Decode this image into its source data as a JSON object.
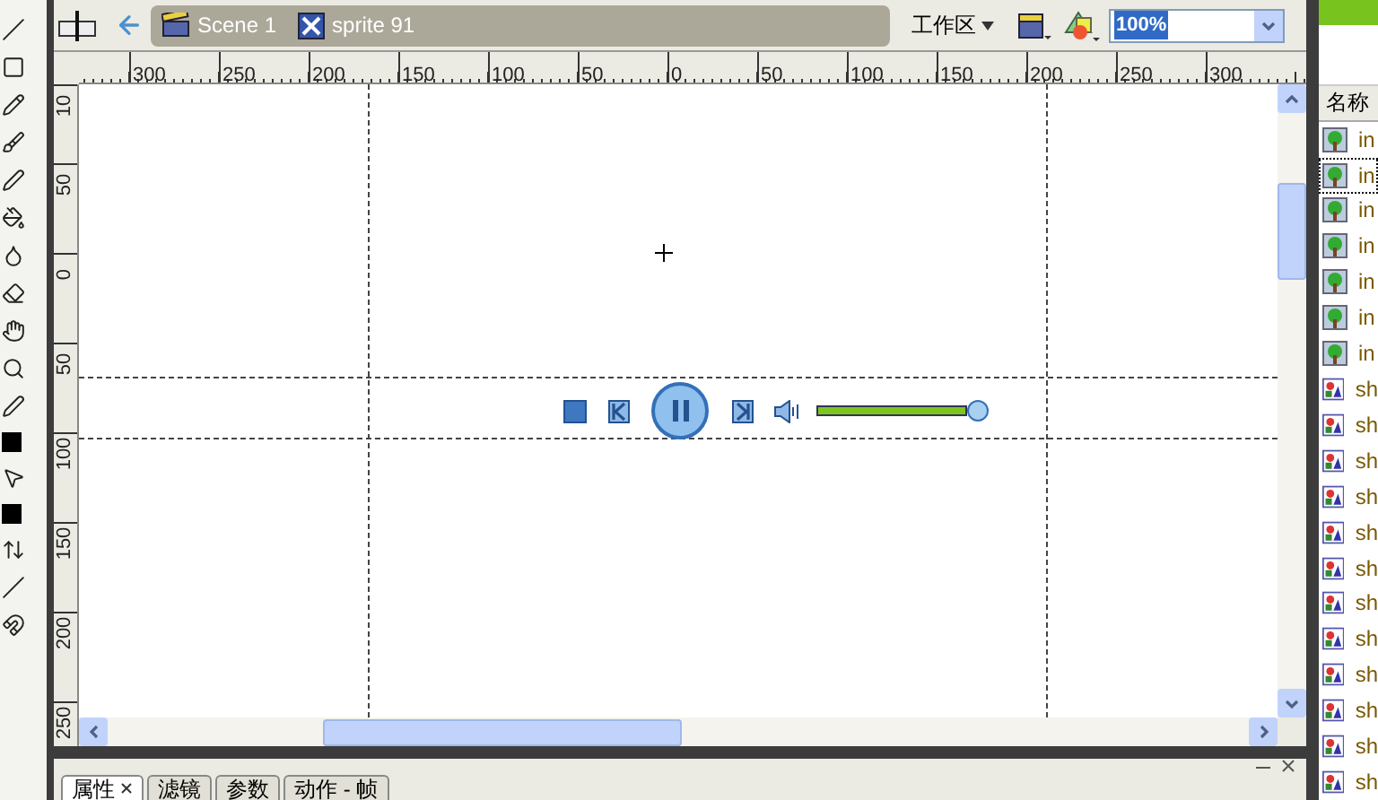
{
  "toolbar": {
    "breadcrumbs": [
      {
        "kind": "scene",
        "label": "Scene 1"
      },
      {
        "kind": "sprite",
        "label": "sprite 91"
      }
    ],
    "workspace_menu": "工作区",
    "zoom": "100%"
  },
  "ruler": {
    "horizontal": [
      "300",
      "250",
      "200",
      "150",
      "100",
      "50",
      "0",
      "50",
      "100",
      "150",
      "200",
      "250",
      "300"
    ],
    "vertical": [
      "10",
      "50",
      "0",
      "50",
      "100",
      "150",
      "200",
      "250"
    ]
  },
  "player": {
    "volume": {
      "level": 1
    }
  },
  "library": {
    "header": "名称",
    "items": [
      {
        "kind": "bitmap",
        "name": "in",
        "selected": false
      },
      {
        "kind": "bitmap",
        "name": "in",
        "selected": true
      },
      {
        "kind": "bitmap",
        "name": "in",
        "selected": false
      },
      {
        "kind": "bitmap",
        "name": "in",
        "selected": false
      },
      {
        "kind": "bitmap",
        "name": "in",
        "selected": false
      },
      {
        "kind": "bitmap",
        "name": "in",
        "selected": false
      },
      {
        "kind": "bitmap",
        "name": "in",
        "selected": false
      },
      {
        "kind": "graphic",
        "name": "sh",
        "selected": false
      },
      {
        "kind": "graphic",
        "name": "sh",
        "selected": false
      },
      {
        "kind": "graphic",
        "name": "sh",
        "selected": false
      },
      {
        "kind": "graphic",
        "name": "sh",
        "selected": false
      },
      {
        "kind": "graphic",
        "name": "sh",
        "selected": false
      },
      {
        "kind": "graphic",
        "name": "sh",
        "selected": false
      },
      {
        "kind": "graphic",
        "name": "sh",
        "selected": false
      },
      {
        "kind": "graphic",
        "name": "sh",
        "selected": false
      },
      {
        "kind": "graphic",
        "name": "sh",
        "selected": false
      },
      {
        "kind": "graphic",
        "name": "sh",
        "selected": false
      },
      {
        "kind": "graphic",
        "name": "sh",
        "selected": false
      },
      {
        "kind": "graphic",
        "name": "sh",
        "selected": false
      }
    ]
  },
  "panel": {
    "tabs": [
      {
        "label": "属性",
        "closable": true,
        "selected": true
      },
      {
        "label": "滤镜",
        "closable": false,
        "selected": false
      },
      {
        "label": "参数",
        "closable": false,
        "selected": false
      },
      {
        "label": "动作 - 帧",
        "closable": false,
        "selected": false
      }
    ]
  }
}
